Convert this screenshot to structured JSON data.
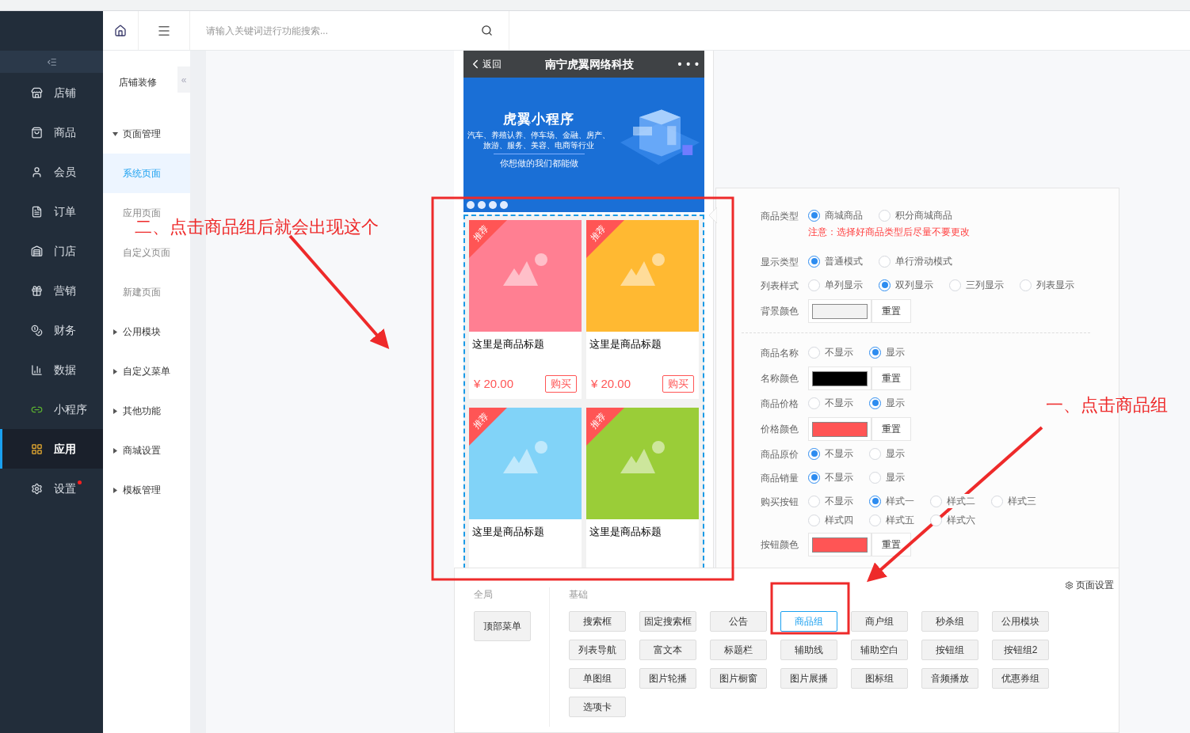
{
  "header": {
    "search_placeholder": "请输入关键词进行功能搜索..."
  },
  "sidebar": {
    "items": [
      {
        "label": "店铺",
        "selected": false,
        "dot": false
      },
      {
        "label": "商品",
        "selected": false,
        "dot": false
      },
      {
        "label": "会员",
        "selected": false,
        "dot": false
      },
      {
        "label": "订单",
        "selected": false,
        "dot": false
      },
      {
        "label": "门店",
        "selected": false,
        "dot": false
      },
      {
        "label": "营销",
        "selected": false,
        "dot": false
      },
      {
        "label": "财务",
        "selected": false,
        "dot": false
      },
      {
        "label": "数据",
        "selected": false,
        "dot": false
      },
      {
        "label": "小程序",
        "selected": false,
        "dot": false
      },
      {
        "label": "应用",
        "selected": true,
        "dot": false
      },
      {
        "label": "设置",
        "selected": false,
        "dot": true
      }
    ]
  },
  "subnav": {
    "title": "店铺装修",
    "collapse": "«",
    "groups": [
      {
        "label": "页面管理",
        "expanded": true,
        "children": [
          {
            "label": "系统页面",
            "selected": true
          },
          {
            "label": "应用页面",
            "selected": false
          },
          {
            "label": "自定义页面",
            "selected": false
          },
          {
            "label": "新建页面",
            "selected": false
          }
        ]
      },
      {
        "label": "公用模块",
        "expanded": false
      },
      {
        "label": "自定义菜单",
        "expanded": false
      },
      {
        "label": "其他功能",
        "expanded": false
      },
      {
        "label": "商城设置",
        "expanded": false
      },
      {
        "label": "模板管理",
        "expanded": false
      }
    ]
  },
  "phone": {
    "back": "返回",
    "title": "南宁虎翼网络科技",
    "more": "• • •",
    "banner": {
      "title": "虎翼小程序",
      "lines": [
        "汽车、养殖认养、停车场、金融、房产、",
        "旅游、服务、美容、电商等行业"
      ],
      "slogan": "你想做的我们都能做"
    },
    "products": [
      {
        "tag": "推荐",
        "title": "这里是商品标题",
        "price": "¥ 20.00",
        "buy": "购买",
        "color": "#ff7f92"
      },
      {
        "tag": "推荐",
        "title": "这里是商品标题",
        "price": "¥ 20.00",
        "buy": "购买",
        "color": "#ffb932"
      },
      {
        "tag": "推荐",
        "title": "这里是商品标题",
        "color": "#81d3f8"
      },
      {
        "tag": "推荐",
        "title": "这里是商品标题",
        "color": "#9acd38"
      }
    ]
  },
  "settings": {
    "rows": [
      {
        "kind": "radio",
        "label": "商品类型",
        "options": [
          {
            "label": "商城商品",
            "selected": true
          },
          {
            "label": "积分商城商品",
            "selected": false
          }
        ],
        "note": "注意：选择好商品类型后尽量不要更改"
      },
      {
        "kind": "radio",
        "label": "显示类型",
        "options": [
          {
            "label": "普通模式",
            "selected": true
          },
          {
            "label": "单行滑动模式",
            "selected": false
          }
        ]
      },
      {
        "kind": "radio",
        "label": "列表样式",
        "options": [
          {
            "label": "单列显示",
            "selected": false
          },
          {
            "label": "双列显示",
            "selected": true
          },
          {
            "label": "三列显示",
            "selected": false
          },
          {
            "label": "列表显示",
            "selected": false
          }
        ]
      },
      {
        "kind": "color",
        "label": "背景颜色",
        "color": "#f2f2f2",
        "button": "重置"
      },
      {
        "kind": "divider"
      },
      {
        "kind": "radio",
        "label": "商品名称",
        "options": [
          {
            "label": "不显示",
            "selected": false
          },
          {
            "label": "显示",
            "selected": true
          }
        ]
      },
      {
        "kind": "color",
        "label": "名称颜色",
        "color": "#000000",
        "button": "重置"
      },
      {
        "kind": "radio",
        "label": "商品价格",
        "options": [
          {
            "label": "不显示",
            "selected": false
          },
          {
            "label": "显示",
            "selected": true
          }
        ]
      },
      {
        "kind": "color",
        "label": "价格颜色",
        "color": "#ff5555",
        "button": "重置"
      },
      {
        "kind": "radio",
        "label": "商品原价",
        "options": [
          {
            "label": "不显示",
            "selected": true
          },
          {
            "label": "显示",
            "selected": false
          }
        ]
      },
      {
        "kind": "radio",
        "label": "商品销量",
        "options": [
          {
            "label": "不显示",
            "selected": true
          },
          {
            "label": "显示",
            "selected": false
          }
        ]
      },
      {
        "kind": "radio",
        "label": "购买按钮",
        "options": [
          {
            "label": "不显示",
            "selected": false
          },
          {
            "label": "样式一",
            "selected": true
          },
          {
            "label": "样式二",
            "selected": false
          },
          {
            "label": "样式三",
            "selected": false
          },
          {
            "label": "样式四",
            "selected": false
          },
          {
            "label": "样式五",
            "selected": false
          },
          {
            "label": "样式六",
            "selected": false
          }
        ]
      },
      {
        "kind": "color",
        "label": "按钮颜色",
        "color": "#ff5555",
        "button": "重置"
      }
    ]
  },
  "components": {
    "page_settings": "页面设置",
    "global_label": "全局",
    "global_items": [
      {
        "label": "顶部菜单",
        "selected": false
      }
    ],
    "basic_label": "基础",
    "basic_items": [
      {
        "label": "搜索框",
        "selected": false
      },
      {
        "label": "固定搜索框",
        "selected": false
      },
      {
        "label": "公告",
        "selected": false
      },
      {
        "label": "商品组",
        "selected": true
      },
      {
        "label": "商户组",
        "selected": false
      },
      {
        "label": "秒杀组",
        "selected": false
      },
      {
        "label": "公用模块",
        "selected": false
      },
      {
        "label": "列表导航",
        "selected": false
      },
      {
        "label": "富文本",
        "selected": false
      },
      {
        "label": "标题栏",
        "selected": false
      },
      {
        "label": "辅助线",
        "selected": false
      },
      {
        "label": "辅助空白",
        "selected": false
      },
      {
        "label": "按钮组",
        "selected": false
      },
      {
        "label": "按钮组2",
        "selected": false
      },
      {
        "label": "单图组",
        "selected": false
      },
      {
        "label": "图片轮播",
        "selected": false
      },
      {
        "label": "图片橱窗",
        "selected": false
      },
      {
        "label": "图片展播",
        "selected": false
      },
      {
        "label": "图标组",
        "selected": false
      },
      {
        "label": "音频播放",
        "selected": false
      },
      {
        "label": "优惠券组",
        "selected": false
      },
      {
        "label": "选项卡",
        "selected": false
      }
    ]
  },
  "annotations": [
    {
      "text": "二、点击商品组后就会出现这个"
    },
    {
      "text": "一、点击商品组"
    }
  ]
}
